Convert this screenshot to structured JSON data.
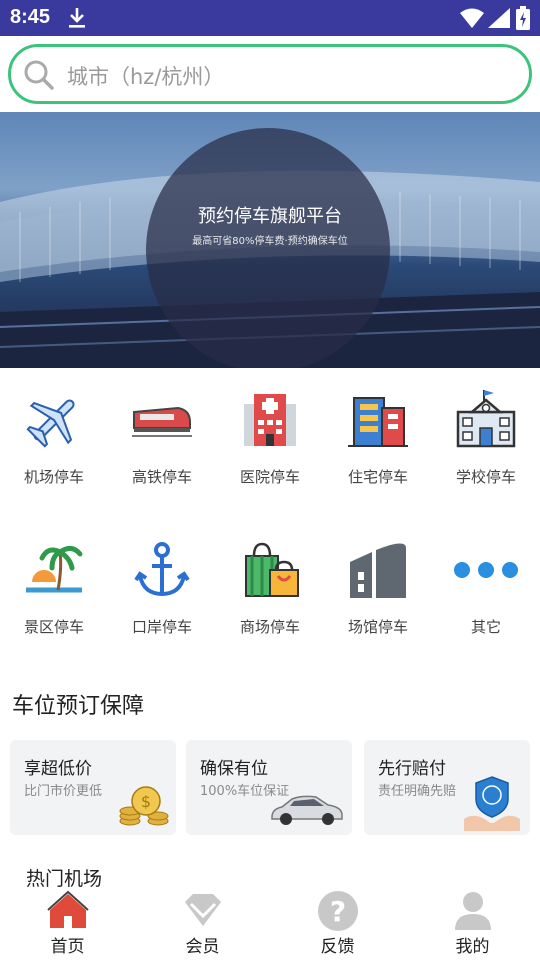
{
  "status_bar": {
    "time": "8:45"
  },
  "search": {
    "placeholder": "城市（hz/杭州）"
  },
  "banner": {
    "title": "预约停车旗舰平台",
    "subtitle": "最高可省80%停车费·预约确保车位"
  },
  "categories": [
    {
      "label": "机场停车",
      "icon": "airplane-icon"
    },
    {
      "label": "高铁停车",
      "icon": "train-icon"
    },
    {
      "label": "医院停车",
      "icon": "hospital-icon"
    },
    {
      "label": "住宅停车",
      "icon": "residence-icon"
    },
    {
      "label": "学校停车",
      "icon": "school-icon"
    },
    {
      "label": "景区停车",
      "icon": "palm-tree-icon"
    },
    {
      "label": "口岸停车",
      "icon": "anchor-icon"
    },
    {
      "label": "商场停车",
      "icon": "shopping-bag-icon"
    },
    {
      "label": "场馆停车",
      "icon": "stadium-icon"
    },
    {
      "label": "其它",
      "icon": "more-dots-icon"
    }
  ],
  "guarantee": {
    "title": "车位预订保障",
    "cards": [
      {
        "title": "享超低价",
        "subtitle": "比门市价更低",
        "icon": "coins-icon"
      },
      {
        "title": "确保有位",
        "subtitle": "100%车位保证",
        "icon": "car-icon"
      },
      {
        "title": "先行赔付",
        "subtitle": "责任明确先赔",
        "icon": "shield-hand-icon"
      }
    ]
  },
  "hot_airports": {
    "title": "热门机场"
  },
  "tabbar": [
    {
      "label": "首页",
      "icon": "home-icon",
      "active": true
    },
    {
      "label": "会员",
      "icon": "diamond-icon"
    },
    {
      "label": "反馈",
      "icon": "question-icon"
    },
    {
      "label": "我的",
      "icon": "user-icon"
    }
  ],
  "colors": {
    "status_bar": "#3a3a9e",
    "search_border": "#3cc47c",
    "active_tab": "#e04a3a",
    "inactive_tab": "#c8c8c8"
  }
}
